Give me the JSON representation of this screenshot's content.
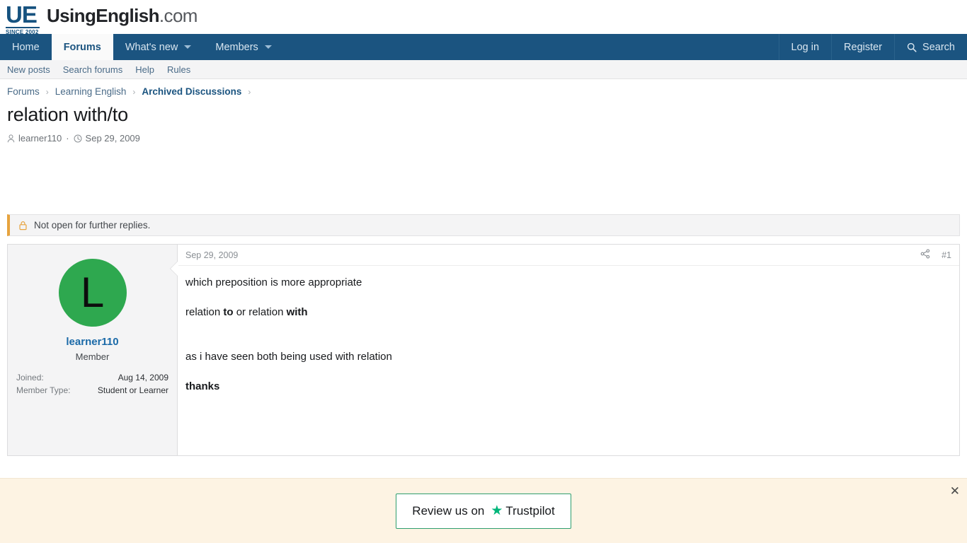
{
  "site": {
    "logo_mark": "UE",
    "logo_since": "SINCE 2002",
    "logo_name": "UsingEnglish",
    "logo_tld": ".com"
  },
  "nav_main": {
    "left_items": [
      {
        "label": "Home",
        "active": false,
        "caret": false
      },
      {
        "label": "Forums",
        "active": true,
        "caret": false
      },
      {
        "label": "What's new",
        "active": false,
        "caret": true
      },
      {
        "label": "Members",
        "active": false,
        "caret": true
      }
    ],
    "right_items": [
      {
        "label": "Log in"
      },
      {
        "label": "Register"
      },
      {
        "label": "Search",
        "icon": "search-icon"
      }
    ]
  },
  "nav_sub": {
    "items": [
      {
        "label": "New posts"
      },
      {
        "label": "Search forums"
      },
      {
        "label": "Help"
      },
      {
        "label": "Rules"
      }
    ]
  },
  "breadcrumb": {
    "items": [
      {
        "label": "Forums",
        "current": false
      },
      {
        "label": "Learning English",
        "current": false
      },
      {
        "label": "Archived Discussions",
        "current": true
      }
    ],
    "separator": "›"
  },
  "thread": {
    "title": "relation with/to",
    "author": "learner110",
    "separator": "·",
    "date": "Sep 29, 2009",
    "author_icon": "user-icon",
    "date_icon": "clock-icon"
  },
  "lock_notice": {
    "icon": "lock-icon",
    "text": "Not open for further replies."
  },
  "post": {
    "date": "Sep 29, 2009",
    "share_icon": "share-icon",
    "post_number": "#1",
    "user": {
      "avatar_letter": "L",
      "avatar_color": "#2ea84f",
      "username": "learner110",
      "user_title": "Member",
      "fields": [
        {
          "label": "Joined:",
          "value": "Aug 14, 2009"
        },
        {
          "label": "Member Type:",
          "value": "Student or Learner"
        }
      ]
    },
    "body": {
      "line1": "which preposition is more appropriate",
      "line2_pre": "relation ",
      "line2_bold1": "to",
      "line2_mid": " or relation ",
      "line2_bold2": "with",
      "line3": "as i have seen both being used with relation",
      "line4_bold": "thanks"
    }
  },
  "trustpilot": {
    "review_text": "Review us on",
    "star_icon": "star-icon",
    "brand": "Trustpilot",
    "close_icon": "close-icon",
    "close_glyph": "✕",
    "star_glyph": "★"
  }
}
